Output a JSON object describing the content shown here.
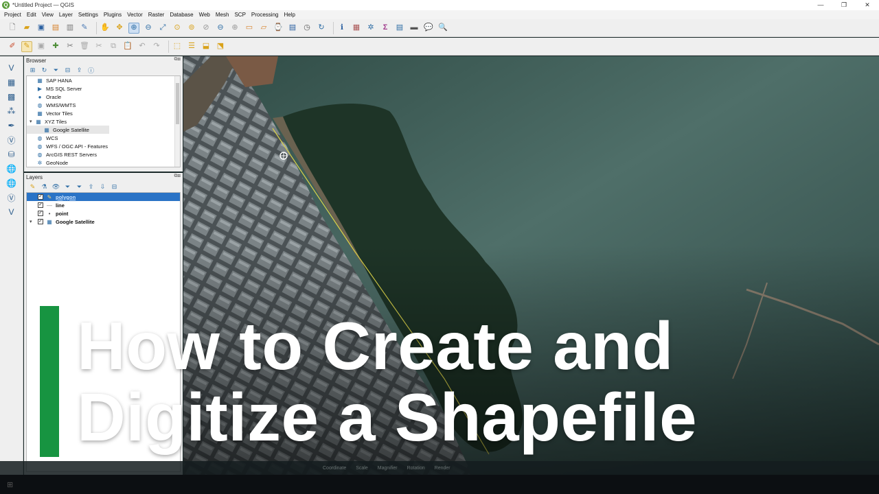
{
  "window": {
    "title": "*Untitled Project — QGIS",
    "controls": [
      "—",
      "❐",
      "✕"
    ]
  },
  "menu": [
    "Project",
    "Edit",
    "View",
    "Layer",
    "Settings",
    "Plugins",
    "Vector",
    "Raster",
    "Database",
    "Web",
    "Mesh",
    "SCP",
    "Processing",
    "Help"
  ],
  "toolbar_icons": {
    "row1": [
      "new-project-icon",
      "open-project-icon",
      "save-project-icon",
      "save-as-icon",
      "print-layout-icon",
      "layout-manager-icon",
      "pan-icon",
      "pan-to-selection-icon",
      "zoom-in-icon",
      "zoom-out-icon",
      "zoom-full-icon",
      "zoom-to-selection-icon",
      "zoom-to-layer-icon",
      "zoom-native-icon",
      "zoom-last-icon",
      "zoom-next-icon",
      "new-map-view-icon",
      "new-3d-map-icon",
      "temporal-controller-icon",
      "bookmark-icon",
      "show-bookmarks-icon",
      "refresh-icon",
      "identify-icon",
      "attribute-table-icon",
      "field-calculator-icon",
      "statistics-icon",
      "table-icon",
      "measure-icon",
      "annotation-icon",
      "map-tips-icon"
    ],
    "row2": [
      "digitize-icon",
      "toggle-editing-icon",
      "save-edits-icon",
      "add-feature-icon",
      "vertex-tool-icon",
      "delete-selected-icon",
      "cut-icon",
      "copy-icon",
      "paste-icon",
      "undo-icon",
      "redo-icon",
      "select-features-icon",
      "select-by-value-icon",
      "deselect-icon",
      "select-location-icon"
    ]
  },
  "left_toolbar_icons": [
    "add-vector-layer-icon",
    "add-raster-layer-icon",
    "add-mesh-layer-icon",
    "add-delimited-text-icon",
    "add-geopackage-icon",
    "add-spatialite-icon",
    "add-postgis-icon",
    "add-wms-icon",
    "add-wcs-icon",
    "add-wfs-icon",
    "new-shapefile-icon"
  ],
  "browser": {
    "title": "Browser",
    "items": [
      {
        "label": "SAP HANA",
        "icon": "database-icon",
        "indent": 0
      },
      {
        "label": "MS SQL Server",
        "icon": "mssql-icon",
        "indent": 0
      },
      {
        "label": "Oracle",
        "icon": "oracle-icon",
        "indent": 0
      },
      {
        "label": "WMS/WMTS",
        "icon": "globe-icon",
        "indent": 0
      },
      {
        "label": "Vector Tiles",
        "icon": "vector-tiles-icon",
        "indent": 0
      },
      {
        "label": "XYZ Tiles",
        "icon": "grid-icon",
        "indent": 0,
        "expanded": true
      },
      {
        "label": "Google Satellite",
        "icon": "grid-icon",
        "indent": 1
      },
      {
        "label": "WCS",
        "icon": "globe-icon",
        "indent": 0
      },
      {
        "label": "WFS / OGC API - Features",
        "icon": "globe-icon",
        "indent": 0
      },
      {
        "label": "ArcGIS REST Servers",
        "icon": "arcgis-icon",
        "indent": 0
      },
      {
        "label": "GeoNode",
        "icon": "geonode-icon",
        "indent": 0
      }
    ]
  },
  "layers": {
    "title": "Layers",
    "items": [
      {
        "label": "polygon",
        "checked": true,
        "selected": true,
        "icon": "pencil-icon"
      },
      {
        "label": "line",
        "checked": true,
        "selected": false,
        "icon": "line-symbol-icon"
      },
      {
        "label": "point",
        "checked": true,
        "selected": false,
        "icon": "point-symbol-icon"
      },
      {
        "label": "Google Satellite",
        "checked": true,
        "selected": false,
        "icon": "grid-icon"
      }
    ]
  },
  "overlay": {
    "line1": "How to Create and",
    "line2": "Digitize a Shapefile",
    "accent_color": "#179441"
  },
  "statusbar": {
    "items": [
      "Coordinate",
      "Scale",
      "Magnifier",
      "Rotation",
      "Render"
    ]
  },
  "colors": {
    "selection": "#2a73c6",
    "water": "#3e5b57",
    "vegetation": "#1f3527"
  }
}
